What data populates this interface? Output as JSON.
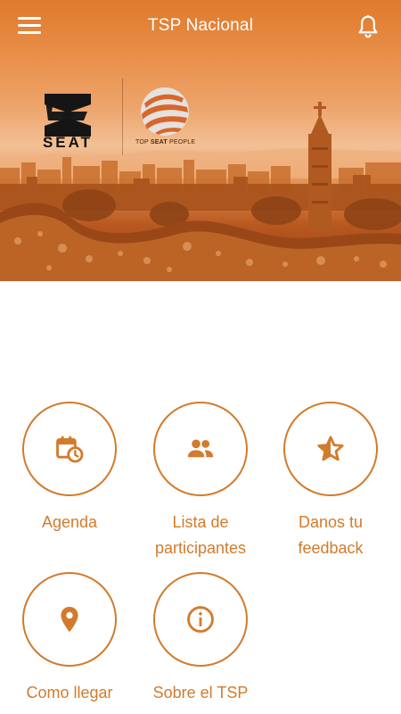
{
  "header": {
    "title": "TSP Nacional",
    "menu_icon": "hamburger-menu-icon",
    "notification_icon": "bell-icon"
  },
  "hero": {
    "brand_logo_text": "SEAT",
    "program_logo_text_regular": "TOP ",
    "program_logo_text_bold": "SEAT",
    "program_logo_text_end": " PEOPLE"
  },
  "menu": {
    "items": [
      {
        "label": "Agenda",
        "icon": "calendar-clock-icon"
      },
      {
        "label": "Lista de participantes",
        "icon": "people-icon"
      },
      {
        "label": "Danos tu feedback",
        "icon": "star-half-icon"
      },
      {
        "label": "Como llegar",
        "icon": "location-pin-icon"
      },
      {
        "label": "Sobre el TSP",
        "icon": "info-icon"
      }
    ]
  },
  "colors": {
    "accent": "#d27b2c",
    "header_bg": "#de7a2c",
    "text_on_header": "#ffffff"
  }
}
